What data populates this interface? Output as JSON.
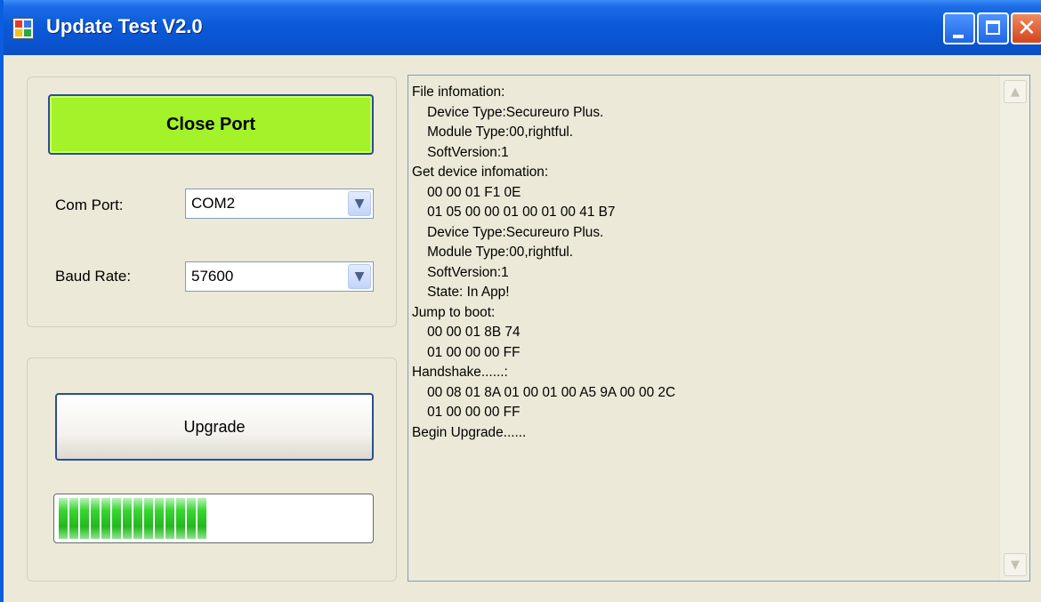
{
  "window": {
    "title": "Update Test V2.0"
  },
  "titlebar_buttons": {
    "minimize_icon": "minimize-icon",
    "maximize_icon": "maximize-icon",
    "close_icon": "close-icon",
    "close_glyph": "✕"
  },
  "port": {
    "close_port_label": "Close Port",
    "com_port_label": "Com Port:",
    "com_port_value": "COM2",
    "baud_rate_label": "Baud Rate:",
    "baud_rate_value": "57600"
  },
  "upgrade": {
    "button_label": "Upgrade",
    "progress_fraction": 0.47
  },
  "log": {
    "lines": [
      "File infomation:",
      "    Device Type:Secureuro Plus.",
      "    Module Type:00,rightful.",
      "    SoftVersion:1",
      "Get device infomation:",
      "    00 00 01 F1 0E",
      "    01 05 00 00 01 00 01 00 41 B7",
      "    Device Type:Secureuro Plus.",
      "    Module Type:00,rightful.",
      "    SoftVersion:1",
      "    State: In App!",
      "Jump to boot:",
      "    00 00 01 8B 74",
      "    01 00 00 00 FF",
      "Handshake......:",
      "    00 08 01 8A 01 00 01 00 A5 9A 00 00 2C",
      "    01 00 00 00 FF",
      "Begin Upgrade......"
    ]
  },
  "colors": {
    "titlebar": "#0b5ad9",
    "close_port_button": "#a3f22a",
    "progress_green": "#23b81e",
    "window_bg": "#ece9d8"
  }
}
